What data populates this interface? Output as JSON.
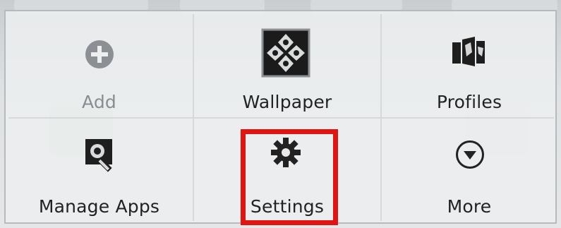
{
  "menu": {
    "items": [
      {
        "label": "Add",
        "icon": "add-circle-icon",
        "enabled": false
      },
      {
        "label": "Wallpaper",
        "icon": "wallpaper-icon",
        "enabled": true
      },
      {
        "label": "Profiles",
        "icon": "profiles-icon",
        "enabled": true
      },
      {
        "label": "Manage Apps",
        "icon": "manage-apps-icon",
        "enabled": true
      },
      {
        "label": "Settings",
        "icon": "gear-icon",
        "enabled": true,
        "highlighted": true
      },
      {
        "label": "More",
        "icon": "chevron-down-circle-icon",
        "enabled": true
      }
    ]
  },
  "colors": {
    "highlight": "#e01410",
    "disabled_text": "#8a8d90",
    "text": "#222222"
  }
}
